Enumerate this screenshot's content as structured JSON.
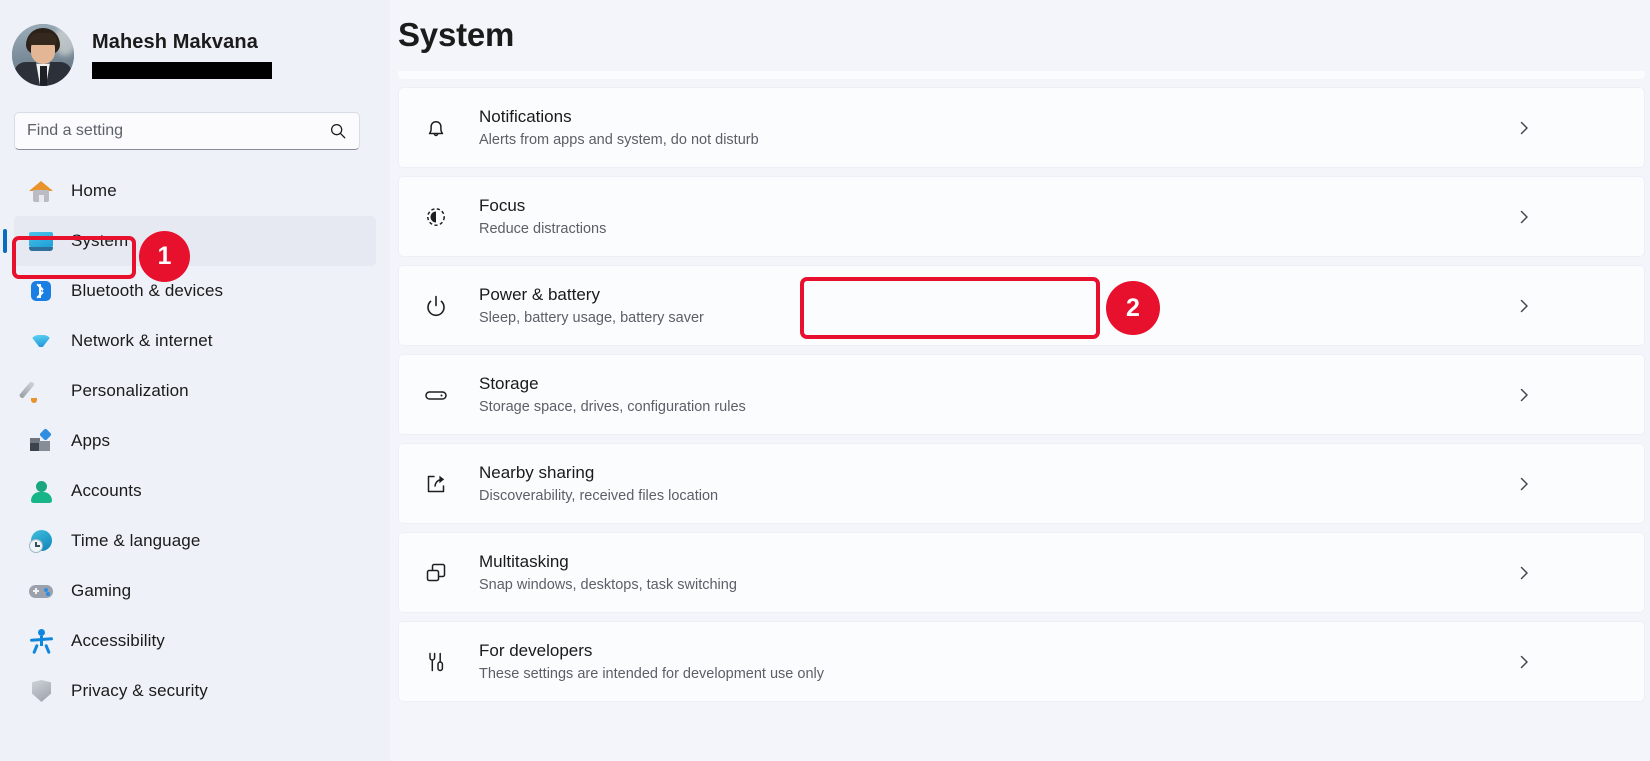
{
  "profile": {
    "name": "Mahesh Makvana",
    "email_redacted": true,
    "avatar_icon": "user-avatar-photo"
  },
  "search": {
    "placeholder": "Find a setting",
    "value": "",
    "icon": "search-icon"
  },
  "sidebar": {
    "items": [
      {
        "label": "Home",
        "icon": "home-icon",
        "selected": false
      },
      {
        "label": "System",
        "icon": "monitor-icon",
        "selected": true
      },
      {
        "label": "Bluetooth & devices",
        "icon": "bluetooth-icon",
        "selected": false
      },
      {
        "label": "Network & internet",
        "icon": "wifi-icon",
        "selected": false
      },
      {
        "label": "Personalization",
        "icon": "paintbrush-icon",
        "selected": false
      },
      {
        "label": "Apps",
        "icon": "apps-grid-icon",
        "selected": false
      },
      {
        "label": "Accounts",
        "icon": "person-icon",
        "selected": false
      },
      {
        "label": "Time & language",
        "icon": "globe-clock-icon",
        "selected": false
      },
      {
        "label": "Gaming",
        "icon": "gamepad-icon",
        "selected": false
      },
      {
        "label": "Accessibility",
        "icon": "accessibility-icon",
        "selected": false
      },
      {
        "label": "Privacy & security",
        "icon": "shield-icon",
        "selected": false
      }
    ]
  },
  "main": {
    "title": "System",
    "chevron_icon": "chevron-right-icon",
    "rows": [
      {
        "title": "Notifications",
        "subtitle": "Alerts from apps and system, do not disturb",
        "icon": "bell-icon",
        "highlighted": false
      },
      {
        "title": "Focus",
        "subtitle": "Reduce distractions",
        "icon": "focus-moon-icon",
        "highlighted": false
      },
      {
        "title": "Power & battery",
        "subtitle": "Sleep, battery usage, battery saver",
        "icon": "power-icon",
        "highlighted": true
      },
      {
        "title": "Storage",
        "subtitle": "Storage space, drives, configuration rules",
        "icon": "drive-icon",
        "highlighted": false
      },
      {
        "title": "Nearby sharing",
        "subtitle": "Discoverability, received files location",
        "icon": "share-icon",
        "highlighted": false
      },
      {
        "title": "Multitasking",
        "subtitle": "Snap windows, desktops, task switching",
        "icon": "windows-stack-icon",
        "highlighted": false
      },
      {
        "title": "For developers",
        "subtitle": "These settings are intended for development use only",
        "icon": "tools-icon",
        "highlighted": false
      }
    ]
  },
  "annotations": {
    "color": "#e8112d",
    "badges": [
      {
        "label": "1",
        "target": "sidebar-item-system"
      },
      {
        "label": "2",
        "target": "settings-row-power-battery"
      }
    ]
  }
}
